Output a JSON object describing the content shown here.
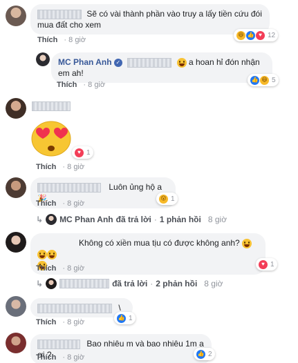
{
  "comments": [
    {
      "text": "Sẽ có vài thành phần vào truy a lấy tiền cứu đói mua đất cho xem",
      "action": "Thích",
      "time": "8 giờ",
      "react_count": "12"
    },
    {
      "author": "MC Phan Anh",
      "text": "a hoan hỉ đón nhận em ah!",
      "action": "Thích",
      "time": "8 giờ",
      "react_count": "5"
    },
    {
      "action": "Thích",
      "time": "8 giờ",
      "react_count": "1"
    },
    {
      "text": "Luôn ủng hộ a",
      "action": "Thích",
      "time": "8 giờ",
      "react_count": "1",
      "reply": {
        "author": "MC Phan Anh",
        "replied": "đã trả lời",
        "sep": "·",
        "count": "1 phản hồi",
        "time": "8 giờ"
      }
    },
    {
      "text": "Không có xiền mua tịu có được không anh?",
      "action": "Thích",
      "time": "8 giờ",
      "react_count": "1",
      "reply": {
        "replied": "đã trả lời",
        "sep": "·",
        "count": "2 phản hồi",
        "time": "8 giờ"
      }
    },
    {
      "text": "\\",
      "action": "Thích",
      "time": "8 giờ",
      "react_count": "1"
    },
    {
      "text": "Bao nhiêu m và bao nhiêu 1m a ơi ?",
      "action": "Thích",
      "time": "8 giờ",
      "react_count": "2"
    }
  ]
}
